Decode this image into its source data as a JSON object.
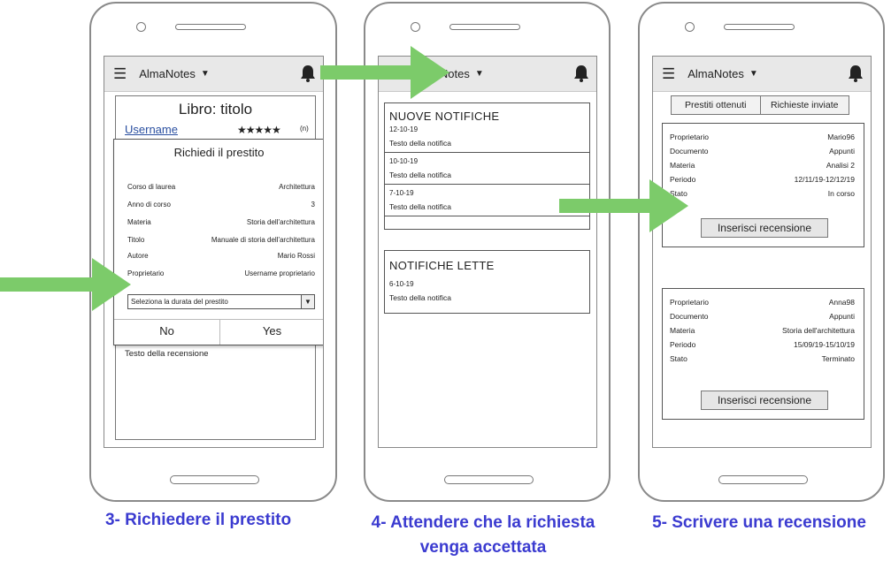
{
  "app": {
    "name": "AlmaNotes"
  },
  "screen1": {
    "book_title": "Libro: titolo",
    "username": "Username",
    "stars": "★★★★★",
    "rating_count": "(n)",
    "dialog": {
      "title": "Richiedi il prestito",
      "fields": [
        {
          "label": "Corso di laurea",
          "value": "Architettura"
        },
        {
          "label": "Anno di corso",
          "value": "3"
        },
        {
          "label": "Materia",
          "value": "Storia dell'architettura"
        },
        {
          "label": "Titolo",
          "value": "Manuale di storia dell'architettura"
        },
        {
          "label": "Autore",
          "value": "Mario Rossi"
        },
        {
          "label": "Proprietario",
          "value": "Username proprietario"
        }
      ],
      "select_placeholder": "Seleziona la durata del prestito",
      "no_label": "No",
      "yes_label": "Yes"
    },
    "review_text": "Testo della recensione"
  },
  "screen2": {
    "new_title": "NUOVE NOTIFICHE",
    "new_items": [
      {
        "date": "12-10-19",
        "text": "Testo della notifica"
      },
      {
        "date": "10-10-19",
        "text": "Testo della notifica"
      },
      {
        "date": "7-10-19",
        "text": "Testo della notifica"
      }
    ],
    "read_title": "NOTIFICHE LETTE",
    "read_items": [
      {
        "date": "6-10-19",
        "text": "Testo della notifica"
      }
    ]
  },
  "screen3": {
    "tabs": [
      "Prestiti ottenuti",
      "Richieste inviate"
    ],
    "cards": [
      {
        "rows": [
          {
            "label": "Proprietario",
            "value": "Mario96"
          },
          {
            "label": "Documento",
            "value": "Appunti"
          },
          {
            "label": "Materia",
            "value": "Analisi 2"
          },
          {
            "label": "Periodo",
            "value": "12/11/19-12/12/19"
          },
          {
            "label": "Stato",
            "value": "In corso"
          }
        ],
        "button": "Inserisci recensione"
      },
      {
        "rows": [
          {
            "label": "Proprietario",
            "value": "Anna98"
          },
          {
            "label": "Documento",
            "value": "Appunti"
          },
          {
            "label": "Materia",
            "value": "Storia dell'architettura"
          },
          {
            "label": "Periodo",
            "value": "15/09/19-15/10/19"
          },
          {
            "label": "Stato",
            "value": "Terminato"
          }
        ],
        "button": "Inserisci recensione"
      }
    ]
  },
  "captions": {
    "step3": "3- Richiedere il prestito",
    "step4_line1": "4- Attendere che la richiesta",
    "step4_line2": "venga accettata",
    "step5": "5- Scrivere una recensione"
  },
  "colors": {
    "arrow": "#7ccb6a",
    "caption": "#3b3bd0"
  }
}
